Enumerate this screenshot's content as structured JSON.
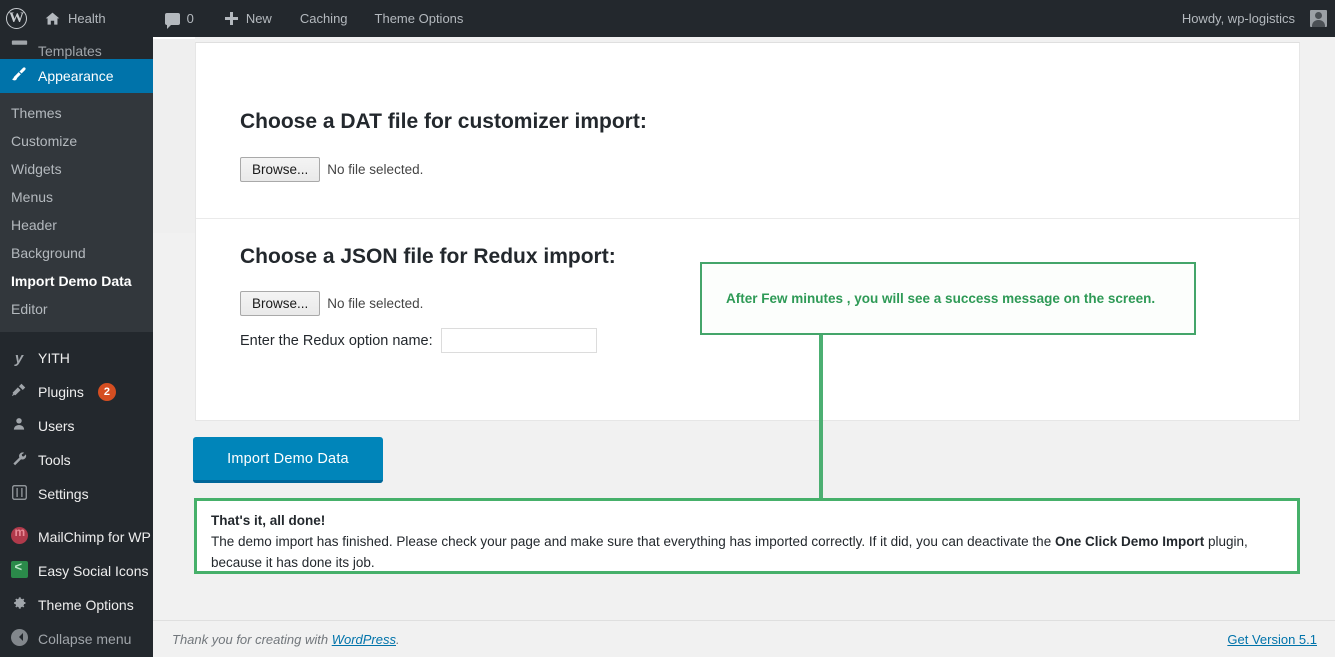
{
  "adminbar": {
    "logo_icon": "wordpress-logo-icon",
    "site_name": "Health",
    "home_icon": "home-icon",
    "comments_icon": "comment-icon",
    "comments_count": "0",
    "new_icon": "plus-icon",
    "new_label": "New",
    "caching_label": "Caching",
    "theme_options_label": "Theme Options",
    "howdy": "Howdy, wp-logistics",
    "avatar_icon": "avatar-icon"
  },
  "sidebar": {
    "clipped_top_item": {
      "label": "Templates",
      "icon": "templates-icon"
    },
    "appearance": {
      "label": "Appearance",
      "icon": "appearance-brush-icon"
    },
    "submenu": [
      {
        "label": "Themes",
        "current": false
      },
      {
        "label": "Customize",
        "current": false
      },
      {
        "label": "Widgets",
        "current": false
      },
      {
        "label": "Menus",
        "current": false
      },
      {
        "label": "Header",
        "current": false
      },
      {
        "label": "Background",
        "current": false
      },
      {
        "label": "Import Demo Data",
        "current": true
      },
      {
        "label": "Editor",
        "current": false
      }
    ],
    "items": [
      {
        "label": "YITH",
        "icon": "yith-icon",
        "badge": ""
      },
      {
        "label": "Plugins",
        "icon": "plugins-plug-icon",
        "badge": "2"
      },
      {
        "label": "Users",
        "icon": "users-icon",
        "badge": ""
      },
      {
        "label": "Tools",
        "icon": "tools-wrench-icon",
        "badge": ""
      },
      {
        "label": "Settings",
        "icon": "settings-sliders-icon",
        "badge": ""
      }
    ],
    "plugin_items": [
      {
        "label": "MailChimp for WP",
        "icon": "mailchimp-icon"
      },
      {
        "label": "Easy Social Icons",
        "icon": "share-icon"
      },
      {
        "label": "Theme Options",
        "icon": "gear-icon"
      }
    ],
    "collapse": {
      "label": "Collapse menu",
      "icon": "collapse-arrow-icon"
    }
  },
  "main": {
    "dat_section": {
      "title": "Choose a DAT file for customizer import:",
      "browse_label": "Browse...",
      "file_status": "No file selected."
    },
    "json_section": {
      "title": "Choose a JSON file for Redux import:",
      "browse_label": "Browse...",
      "file_status": "No file selected.",
      "redux_label": "Enter the Redux option name:",
      "redux_value": "",
      "redux_placeholder": ""
    },
    "import_button_label": "Import Demo Data"
  },
  "annotation": {
    "text": "After Few minutes , you will see a success message on the screen.",
    "border_color": "#44a56a",
    "text_color": "#2e9a56"
  },
  "notice": {
    "title": "That's it, all done!",
    "body_part1": "The demo import has finished. Please check your page and make sure that everything has imported correctly. If it did, you can deactivate the ",
    "body_strong": "One Click Demo Import",
    "body_part2": " plugin, because it has done its job.",
    "border_color": "#46b06a"
  },
  "footer": {
    "thanks_prefix": "Thank you for creating with ",
    "wordpress_link": "WordPress",
    "thanks_suffix": ".",
    "version_link": "Get Version 5.1"
  },
  "colors": {
    "admin_blue": "#0073aa",
    "button_blue": "#0085ba",
    "button_blue_dark": "#006799",
    "sidebar_bg": "#23282d",
    "submenu_bg": "#32373c",
    "badge_orange": "#d54e21",
    "green": "#46b06a"
  }
}
